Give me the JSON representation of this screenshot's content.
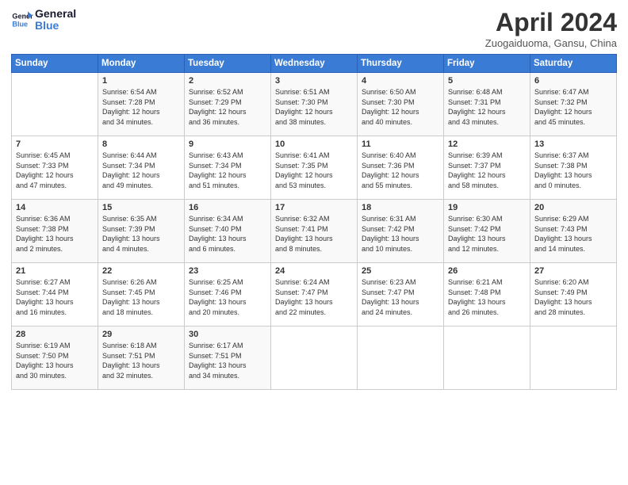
{
  "header": {
    "logo_line1": "General",
    "logo_line2": "Blue",
    "month_title": "April 2024",
    "location": "Zuogaiduoma, Gansu, China"
  },
  "weekdays": [
    "Sunday",
    "Monday",
    "Tuesday",
    "Wednesday",
    "Thursday",
    "Friday",
    "Saturday"
  ],
  "weeks": [
    [
      {
        "day": "",
        "info": ""
      },
      {
        "day": "1",
        "info": "Sunrise: 6:54 AM\nSunset: 7:28 PM\nDaylight: 12 hours\nand 34 minutes."
      },
      {
        "day": "2",
        "info": "Sunrise: 6:52 AM\nSunset: 7:29 PM\nDaylight: 12 hours\nand 36 minutes."
      },
      {
        "day": "3",
        "info": "Sunrise: 6:51 AM\nSunset: 7:30 PM\nDaylight: 12 hours\nand 38 minutes."
      },
      {
        "day": "4",
        "info": "Sunrise: 6:50 AM\nSunset: 7:30 PM\nDaylight: 12 hours\nand 40 minutes."
      },
      {
        "day": "5",
        "info": "Sunrise: 6:48 AM\nSunset: 7:31 PM\nDaylight: 12 hours\nand 43 minutes."
      },
      {
        "day": "6",
        "info": "Sunrise: 6:47 AM\nSunset: 7:32 PM\nDaylight: 12 hours\nand 45 minutes."
      }
    ],
    [
      {
        "day": "7",
        "info": "Sunrise: 6:45 AM\nSunset: 7:33 PM\nDaylight: 12 hours\nand 47 minutes."
      },
      {
        "day": "8",
        "info": "Sunrise: 6:44 AM\nSunset: 7:34 PM\nDaylight: 12 hours\nand 49 minutes."
      },
      {
        "day": "9",
        "info": "Sunrise: 6:43 AM\nSunset: 7:34 PM\nDaylight: 12 hours\nand 51 minutes."
      },
      {
        "day": "10",
        "info": "Sunrise: 6:41 AM\nSunset: 7:35 PM\nDaylight: 12 hours\nand 53 minutes."
      },
      {
        "day": "11",
        "info": "Sunrise: 6:40 AM\nSunset: 7:36 PM\nDaylight: 12 hours\nand 55 minutes."
      },
      {
        "day": "12",
        "info": "Sunrise: 6:39 AM\nSunset: 7:37 PM\nDaylight: 12 hours\nand 58 minutes."
      },
      {
        "day": "13",
        "info": "Sunrise: 6:37 AM\nSunset: 7:38 PM\nDaylight: 13 hours\nand 0 minutes."
      }
    ],
    [
      {
        "day": "14",
        "info": "Sunrise: 6:36 AM\nSunset: 7:38 PM\nDaylight: 13 hours\nand 2 minutes."
      },
      {
        "day": "15",
        "info": "Sunrise: 6:35 AM\nSunset: 7:39 PM\nDaylight: 13 hours\nand 4 minutes."
      },
      {
        "day": "16",
        "info": "Sunrise: 6:34 AM\nSunset: 7:40 PM\nDaylight: 13 hours\nand 6 minutes."
      },
      {
        "day": "17",
        "info": "Sunrise: 6:32 AM\nSunset: 7:41 PM\nDaylight: 13 hours\nand 8 minutes."
      },
      {
        "day": "18",
        "info": "Sunrise: 6:31 AM\nSunset: 7:42 PM\nDaylight: 13 hours\nand 10 minutes."
      },
      {
        "day": "19",
        "info": "Sunrise: 6:30 AM\nSunset: 7:42 PM\nDaylight: 13 hours\nand 12 minutes."
      },
      {
        "day": "20",
        "info": "Sunrise: 6:29 AM\nSunset: 7:43 PM\nDaylight: 13 hours\nand 14 minutes."
      }
    ],
    [
      {
        "day": "21",
        "info": "Sunrise: 6:27 AM\nSunset: 7:44 PM\nDaylight: 13 hours\nand 16 minutes."
      },
      {
        "day": "22",
        "info": "Sunrise: 6:26 AM\nSunset: 7:45 PM\nDaylight: 13 hours\nand 18 minutes."
      },
      {
        "day": "23",
        "info": "Sunrise: 6:25 AM\nSunset: 7:46 PM\nDaylight: 13 hours\nand 20 minutes."
      },
      {
        "day": "24",
        "info": "Sunrise: 6:24 AM\nSunset: 7:47 PM\nDaylight: 13 hours\nand 22 minutes."
      },
      {
        "day": "25",
        "info": "Sunrise: 6:23 AM\nSunset: 7:47 PM\nDaylight: 13 hours\nand 24 minutes."
      },
      {
        "day": "26",
        "info": "Sunrise: 6:21 AM\nSunset: 7:48 PM\nDaylight: 13 hours\nand 26 minutes."
      },
      {
        "day": "27",
        "info": "Sunrise: 6:20 AM\nSunset: 7:49 PM\nDaylight: 13 hours\nand 28 minutes."
      }
    ],
    [
      {
        "day": "28",
        "info": "Sunrise: 6:19 AM\nSunset: 7:50 PM\nDaylight: 13 hours\nand 30 minutes."
      },
      {
        "day": "29",
        "info": "Sunrise: 6:18 AM\nSunset: 7:51 PM\nDaylight: 13 hours\nand 32 minutes."
      },
      {
        "day": "30",
        "info": "Sunrise: 6:17 AM\nSunset: 7:51 PM\nDaylight: 13 hours\nand 34 minutes."
      },
      {
        "day": "",
        "info": ""
      },
      {
        "day": "",
        "info": ""
      },
      {
        "day": "",
        "info": ""
      },
      {
        "day": "",
        "info": ""
      }
    ]
  ]
}
